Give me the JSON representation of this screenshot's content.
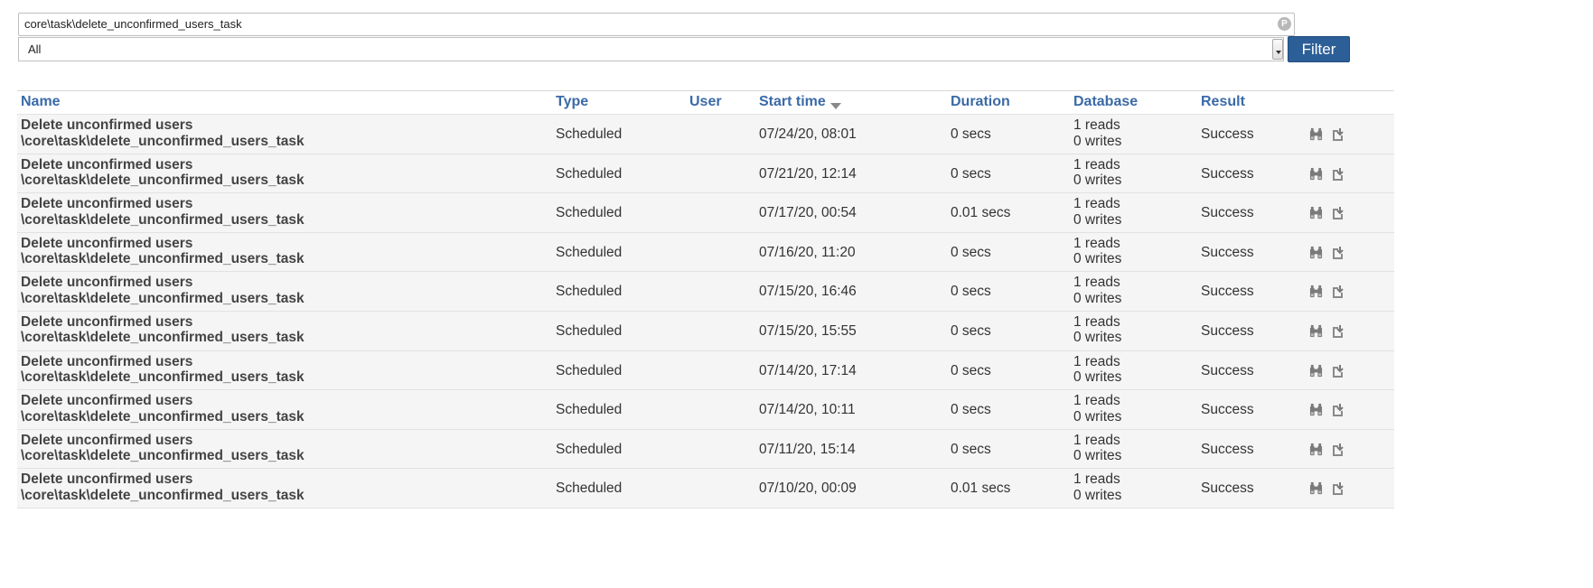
{
  "filter": {
    "search_value": "core\\task\\delete_unconfirmed_users_task",
    "search_icon": "p-icon",
    "status_select_value": "All",
    "button_label": "Filter"
  },
  "table": {
    "headers": {
      "name": "Name",
      "type": "Type",
      "user": "User",
      "start_time": "Start time",
      "duration": "Duration",
      "database": "Database",
      "result": "Result"
    },
    "sort_icon": "sort-desc-icon",
    "rows": [
      {
        "name": "Delete unconfirmed users",
        "classname": "\\core\\task\\delete_unconfirmed_users_task",
        "type": "Scheduled",
        "user": "",
        "start_time": "07/24/20, 08:01",
        "duration": "0 secs",
        "reads": "1 reads",
        "writes": "0 writes",
        "result": "Success"
      },
      {
        "name": "Delete unconfirmed users",
        "classname": "\\core\\task\\delete_unconfirmed_users_task",
        "type": "Scheduled",
        "user": "",
        "start_time": "07/21/20, 12:14",
        "duration": "0 secs",
        "reads": "1 reads",
        "writes": "0 writes",
        "result": "Success"
      },
      {
        "name": "Delete unconfirmed users",
        "classname": "\\core\\task\\delete_unconfirmed_users_task",
        "type": "Scheduled",
        "user": "",
        "start_time": "07/17/20, 00:54",
        "duration": "0.01 secs",
        "reads": "1 reads",
        "writes": "0 writes",
        "result": "Success"
      },
      {
        "name": "Delete unconfirmed users",
        "classname": "\\core\\task\\delete_unconfirmed_users_task",
        "type": "Scheduled",
        "user": "",
        "start_time": "07/16/20, 11:20",
        "duration": "0 secs",
        "reads": "1 reads",
        "writes": "0 writes",
        "result": "Success"
      },
      {
        "name": "Delete unconfirmed users",
        "classname": "\\core\\task\\delete_unconfirmed_users_task",
        "type": "Scheduled",
        "user": "",
        "start_time": "07/15/20, 16:46",
        "duration": "0 secs",
        "reads": "1 reads",
        "writes": "0 writes",
        "result": "Success"
      },
      {
        "name": "Delete unconfirmed users",
        "classname": "\\core\\task\\delete_unconfirmed_users_task",
        "type": "Scheduled",
        "user": "",
        "start_time": "07/15/20, 15:55",
        "duration": "0 secs",
        "reads": "1 reads",
        "writes": "0 writes",
        "result": "Success"
      },
      {
        "name": "Delete unconfirmed users",
        "classname": "\\core\\task\\delete_unconfirmed_users_task",
        "type": "Scheduled",
        "user": "",
        "start_time": "07/14/20, 17:14",
        "duration": "0 secs",
        "reads": "1 reads",
        "writes": "0 writes",
        "result": "Success"
      },
      {
        "name": "Delete unconfirmed users",
        "classname": "\\core\\task\\delete_unconfirmed_users_task",
        "type": "Scheduled",
        "user": "",
        "start_time": "07/14/20, 10:11",
        "duration": "0 secs",
        "reads": "1 reads",
        "writes": "0 writes",
        "result": "Success"
      },
      {
        "name": "Delete unconfirmed users",
        "classname": "\\core\\task\\delete_unconfirmed_users_task",
        "type": "Scheduled",
        "user": "",
        "start_time": "07/11/20, 15:14",
        "duration": "0 secs",
        "reads": "1 reads",
        "writes": "0 writes",
        "result": "Success"
      },
      {
        "name": "Delete unconfirmed users",
        "classname": "\\core\\task\\delete_unconfirmed_users_task",
        "type": "Scheduled",
        "user": "",
        "start_time": "07/10/20, 00:09",
        "duration": "0.01 secs",
        "reads": "1 reads",
        "writes": "0 writes",
        "result": "Success"
      }
    ],
    "row_action_icons": [
      "binoculars-icon",
      "download-icon"
    ]
  },
  "colors": {
    "link_blue": "#3a6aa7",
    "button_blue": "#2c5f97",
    "row_background": "#f5f5f5"
  }
}
